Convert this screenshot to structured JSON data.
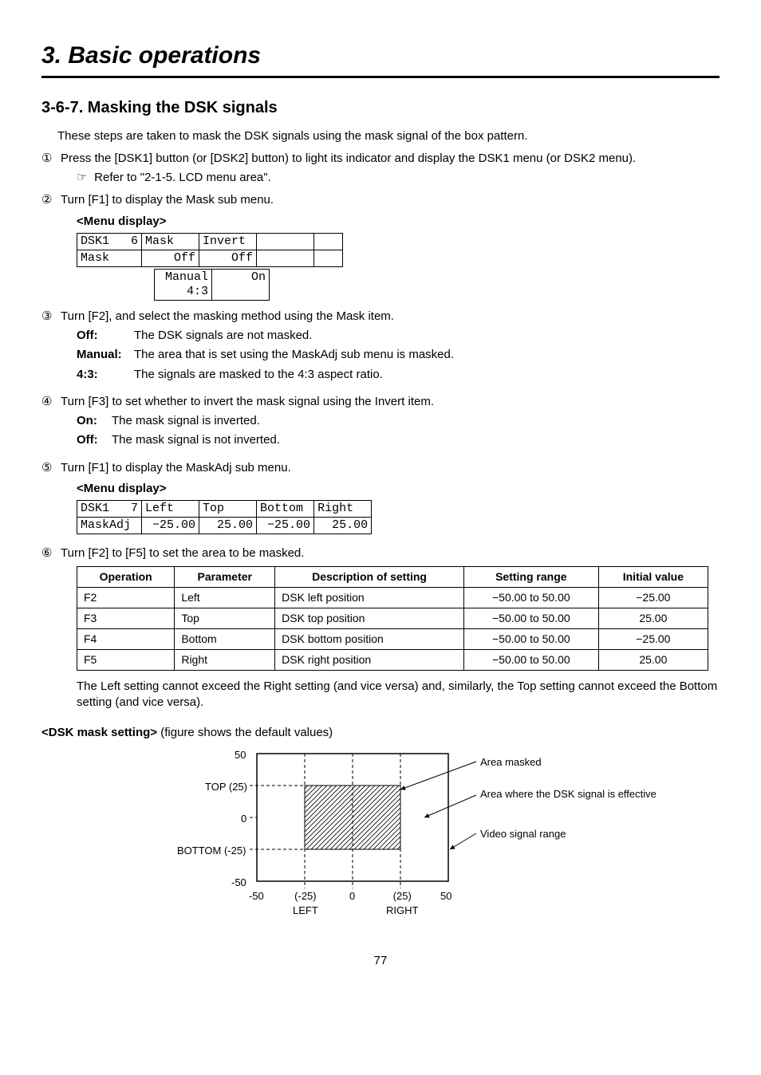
{
  "chapter_title": "3. Basic operations",
  "section_title": "3-6-7. Masking the DSK signals",
  "intro": "These steps are taken to mask the DSK signals using the mask signal of the box pattern.",
  "steps": {
    "s1_num": "①",
    "s1_text": "Press the [DSK1] button (or [DSK2] button) to light its indicator and display the DSK1 menu (or DSK2 menu).",
    "s1_ref": "Refer to \"2-1-5. LCD menu area\".",
    "s2_num": "②",
    "s2_text": "Turn [F1] to display the Mask sub menu.",
    "s3_num": "③",
    "s3_text": "Turn [F2], and select the masking method using the Mask item.",
    "s4_num": "④",
    "s4_text": "Turn [F3] to set whether to invert the mask signal using the Invert item.",
    "s5_num": "⑤",
    "s5_text": "Turn [F1] to display the MaskAdj sub menu.",
    "s6_num": "⑥",
    "s6_text": "Turn [F2] to [F5] to set the area to be masked."
  },
  "menu_display_label": "<Menu display>",
  "lcd1": {
    "r1c1": "DSK1   6",
    "r1c2": "Mask   ",
    "r1c3": "Invert ",
    "r2c1": "Mask    ",
    "r2c2": "    Off",
    "r2c3": "    Off",
    "sub_c2": " Manual\n    4:3",
    "sub_c3": "     On"
  },
  "mask_defs": {
    "off_t": "Off:",
    "off_d": "The DSK signals are not masked.",
    "man_t": "Manual:",
    "man_d": "The area that is set using the MaskAdj sub menu is masked.",
    "r43_t": "4:3:",
    "r43_d": "The signals are masked to the 4:3 aspect ratio."
  },
  "invert_defs": {
    "on_t": "On:",
    "on_d": "The mask signal is inverted.",
    "off_t": "Off:",
    "off_d": "The mask signal is not inverted."
  },
  "lcd2": {
    "r1c1": "DSK1   7",
    "r1c2": "Left   ",
    "r1c3": "Top    ",
    "r1c4": "Bottom ",
    "r1c5": "Right  ",
    "r2c1": "MaskAdj ",
    "r2c2": " −25.00",
    "r2c3": "  25.00",
    "r2c4": " −25.00",
    "r2c5": "  25.00"
  },
  "param_headers": {
    "op": "Operation",
    "param": "Parameter",
    "desc": "Description of setting",
    "range": "Setting range",
    "init": "Initial value"
  },
  "param_rows": [
    {
      "op": "F2",
      "param": "Left",
      "desc": "DSK left position",
      "range": "−50.00 to 50.00",
      "init": "−25.00"
    },
    {
      "op": "F3",
      "param": "Top",
      "desc": "DSK top position",
      "range": "−50.00 to 50.00",
      "init": "25.00"
    },
    {
      "op": "F4",
      "param": "Bottom",
      "desc": "DSK bottom position",
      "range": "−50.00 to 50.00",
      "init": "−25.00"
    },
    {
      "op": "F5",
      "param": "Right",
      "desc": "DSK right position",
      "range": "−50.00 to 50.00",
      "init": "25.00"
    }
  ],
  "constraint_note": "The Left setting cannot exceed the Right setting (and vice versa) and, similarly, the Top setting cannot exceed the Bottom setting (and vice versa).",
  "figure_heading_bold": "<DSK mask setting>",
  "figure_heading_rest": " (figure shows the default values)",
  "diagram": {
    "y50": "50",
    "ytop": "TOP (25)",
    "y0": "0",
    "ybot": "BOTTOM (-25)",
    "yn50": "-50",
    "xn50": "-50",
    "xleft_val": "(-25)",
    "xleft_lbl": "LEFT",
    "x0": "0",
    "xright_val": "(25)",
    "xright_lbl": "RIGHT",
    "x50": "50",
    "legend1": "Area masked",
    "legend2": "Area where the DSK signal is effective",
    "legend3": "Video signal range"
  },
  "page_number": "77"
}
